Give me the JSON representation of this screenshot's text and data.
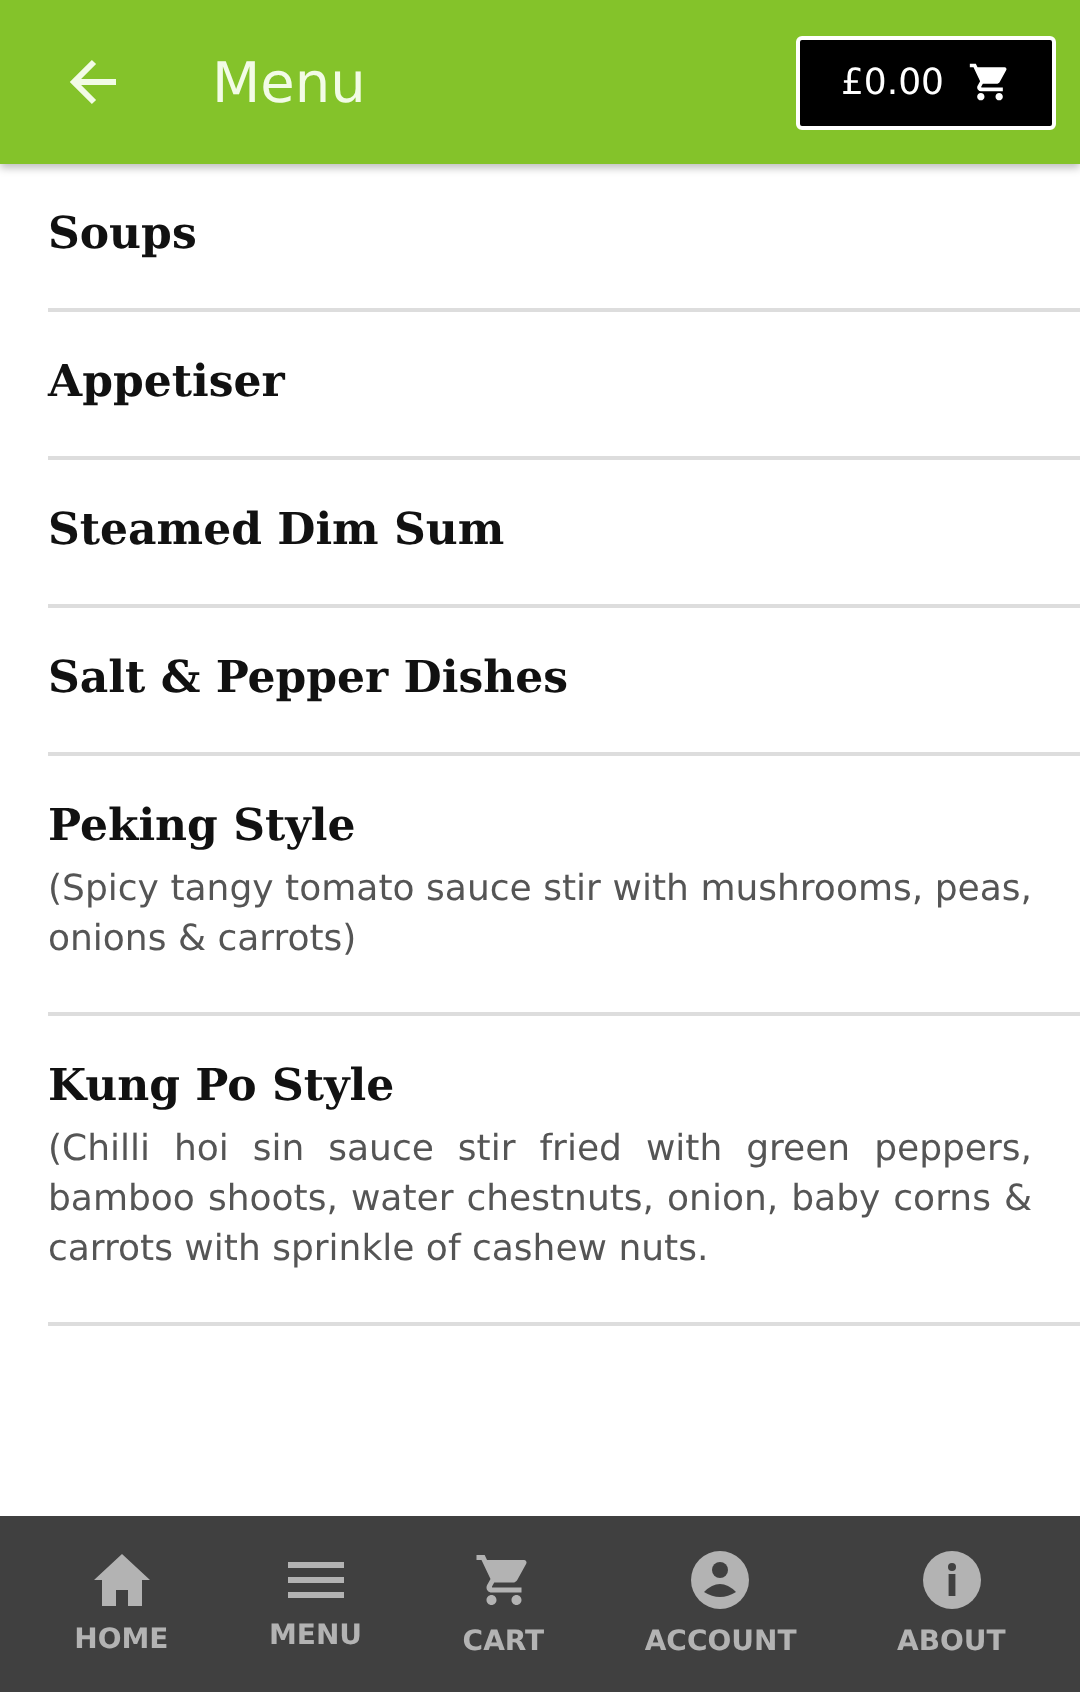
{
  "header": {
    "title": "Menu",
    "cart_total": "£0.00"
  },
  "categories": [
    {
      "name": "Soups"
    },
    {
      "name": "Appetiser"
    },
    {
      "name": "Steamed Dim Sum"
    },
    {
      "name": "Salt & Pepper Dishes"
    },
    {
      "name": "Peking Style",
      "description": "(Spicy tangy tomato sauce stir with mushrooms, peas, onions & carrots)"
    },
    {
      "name": "Kung Po Style",
      "description": "(Chilli hoi sin sauce stir fried with green peppers, bamboo shoots, water chestnuts, onion, baby corns & carrots with sprinkle of cashew nuts."
    }
  ],
  "bottom_nav": [
    {
      "kind": "home",
      "label": "HOME"
    },
    {
      "kind": "menu",
      "label": "MENU"
    },
    {
      "kind": "cart",
      "label": "CART"
    },
    {
      "kind": "account",
      "label": "ACCOUNT"
    },
    {
      "kind": "about",
      "label": "ABOUT"
    }
  ]
}
